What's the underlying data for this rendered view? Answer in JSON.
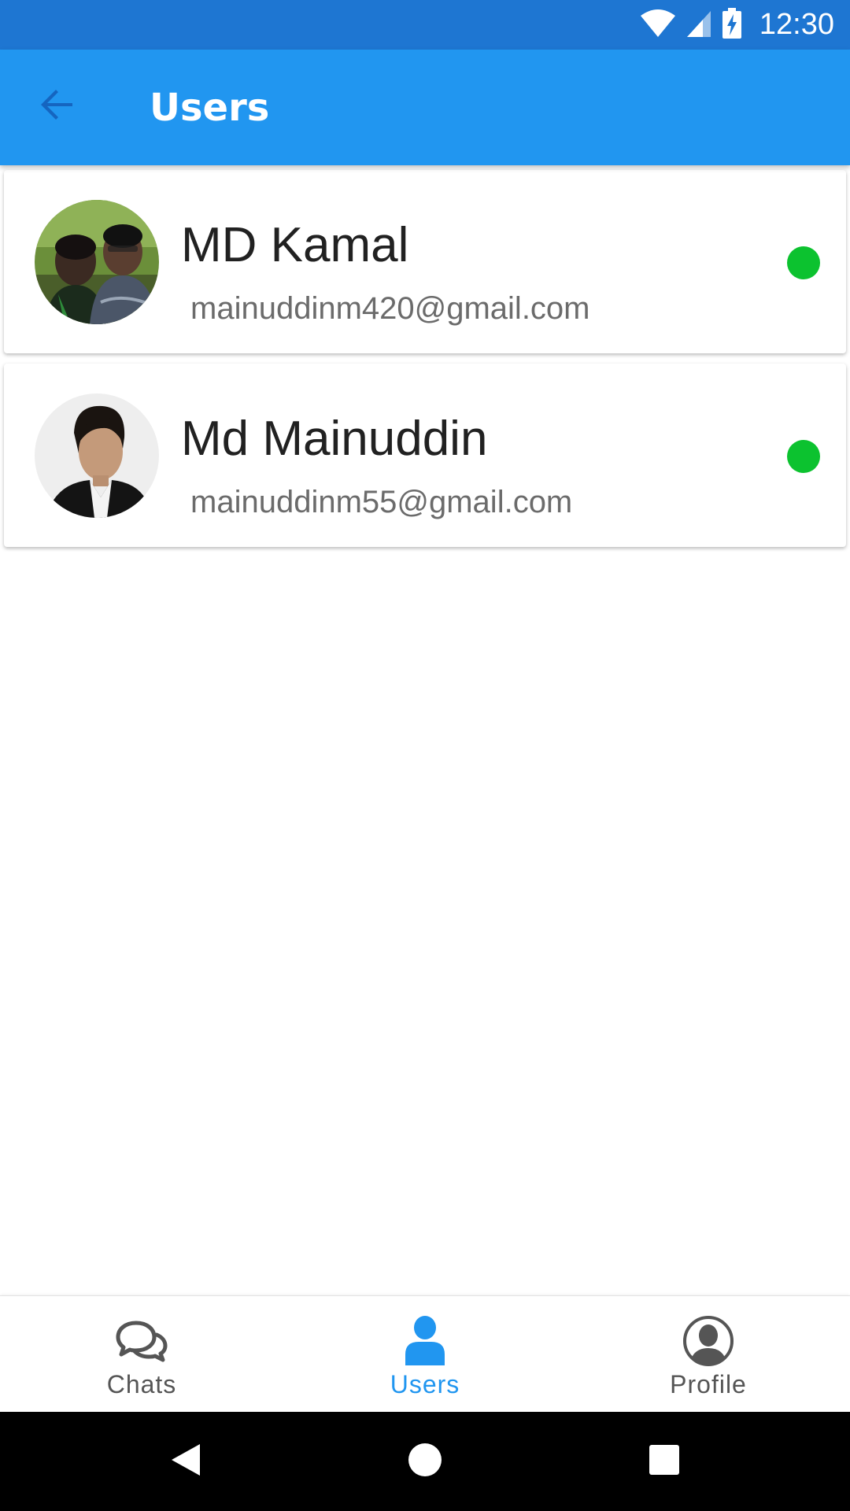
{
  "status_bar": {
    "time": "12:30",
    "icons": [
      "wifi-icon",
      "signal-icon",
      "battery-charging-icon"
    ]
  },
  "app_bar": {
    "title": "Users",
    "back_icon": "arrow-back-icon"
  },
  "users": [
    {
      "name": "MD Kamal",
      "email": "mainuddinm420@gmail.com",
      "online": true
    },
    {
      "name": "Md Mainuddin",
      "email": "mainuddinm55@gmail.com",
      "online": true
    }
  ],
  "bottom_nav": {
    "items": [
      {
        "label": "Chats",
        "icon": "chat-bubbles-icon",
        "active": false
      },
      {
        "label": "Users",
        "icon": "person-icon",
        "active": true
      },
      {
        "label": "Profile",
        "icon": "profile-icon",
        "active": false
      }
    ]
  },
  "system_nav": {
    "icons": [
      "back-triangle-icon",
      "home-circle-icon",
      "recents-square-icon"
    ]
  },
  "colors": {
    "status_bar": "#1E76D2",
    "app_bar": "#2196F0",
    "online": "#0CC22F",
    "active_nav": "#2196F0",
    "inactive_nav": "#555555"
  }
}
